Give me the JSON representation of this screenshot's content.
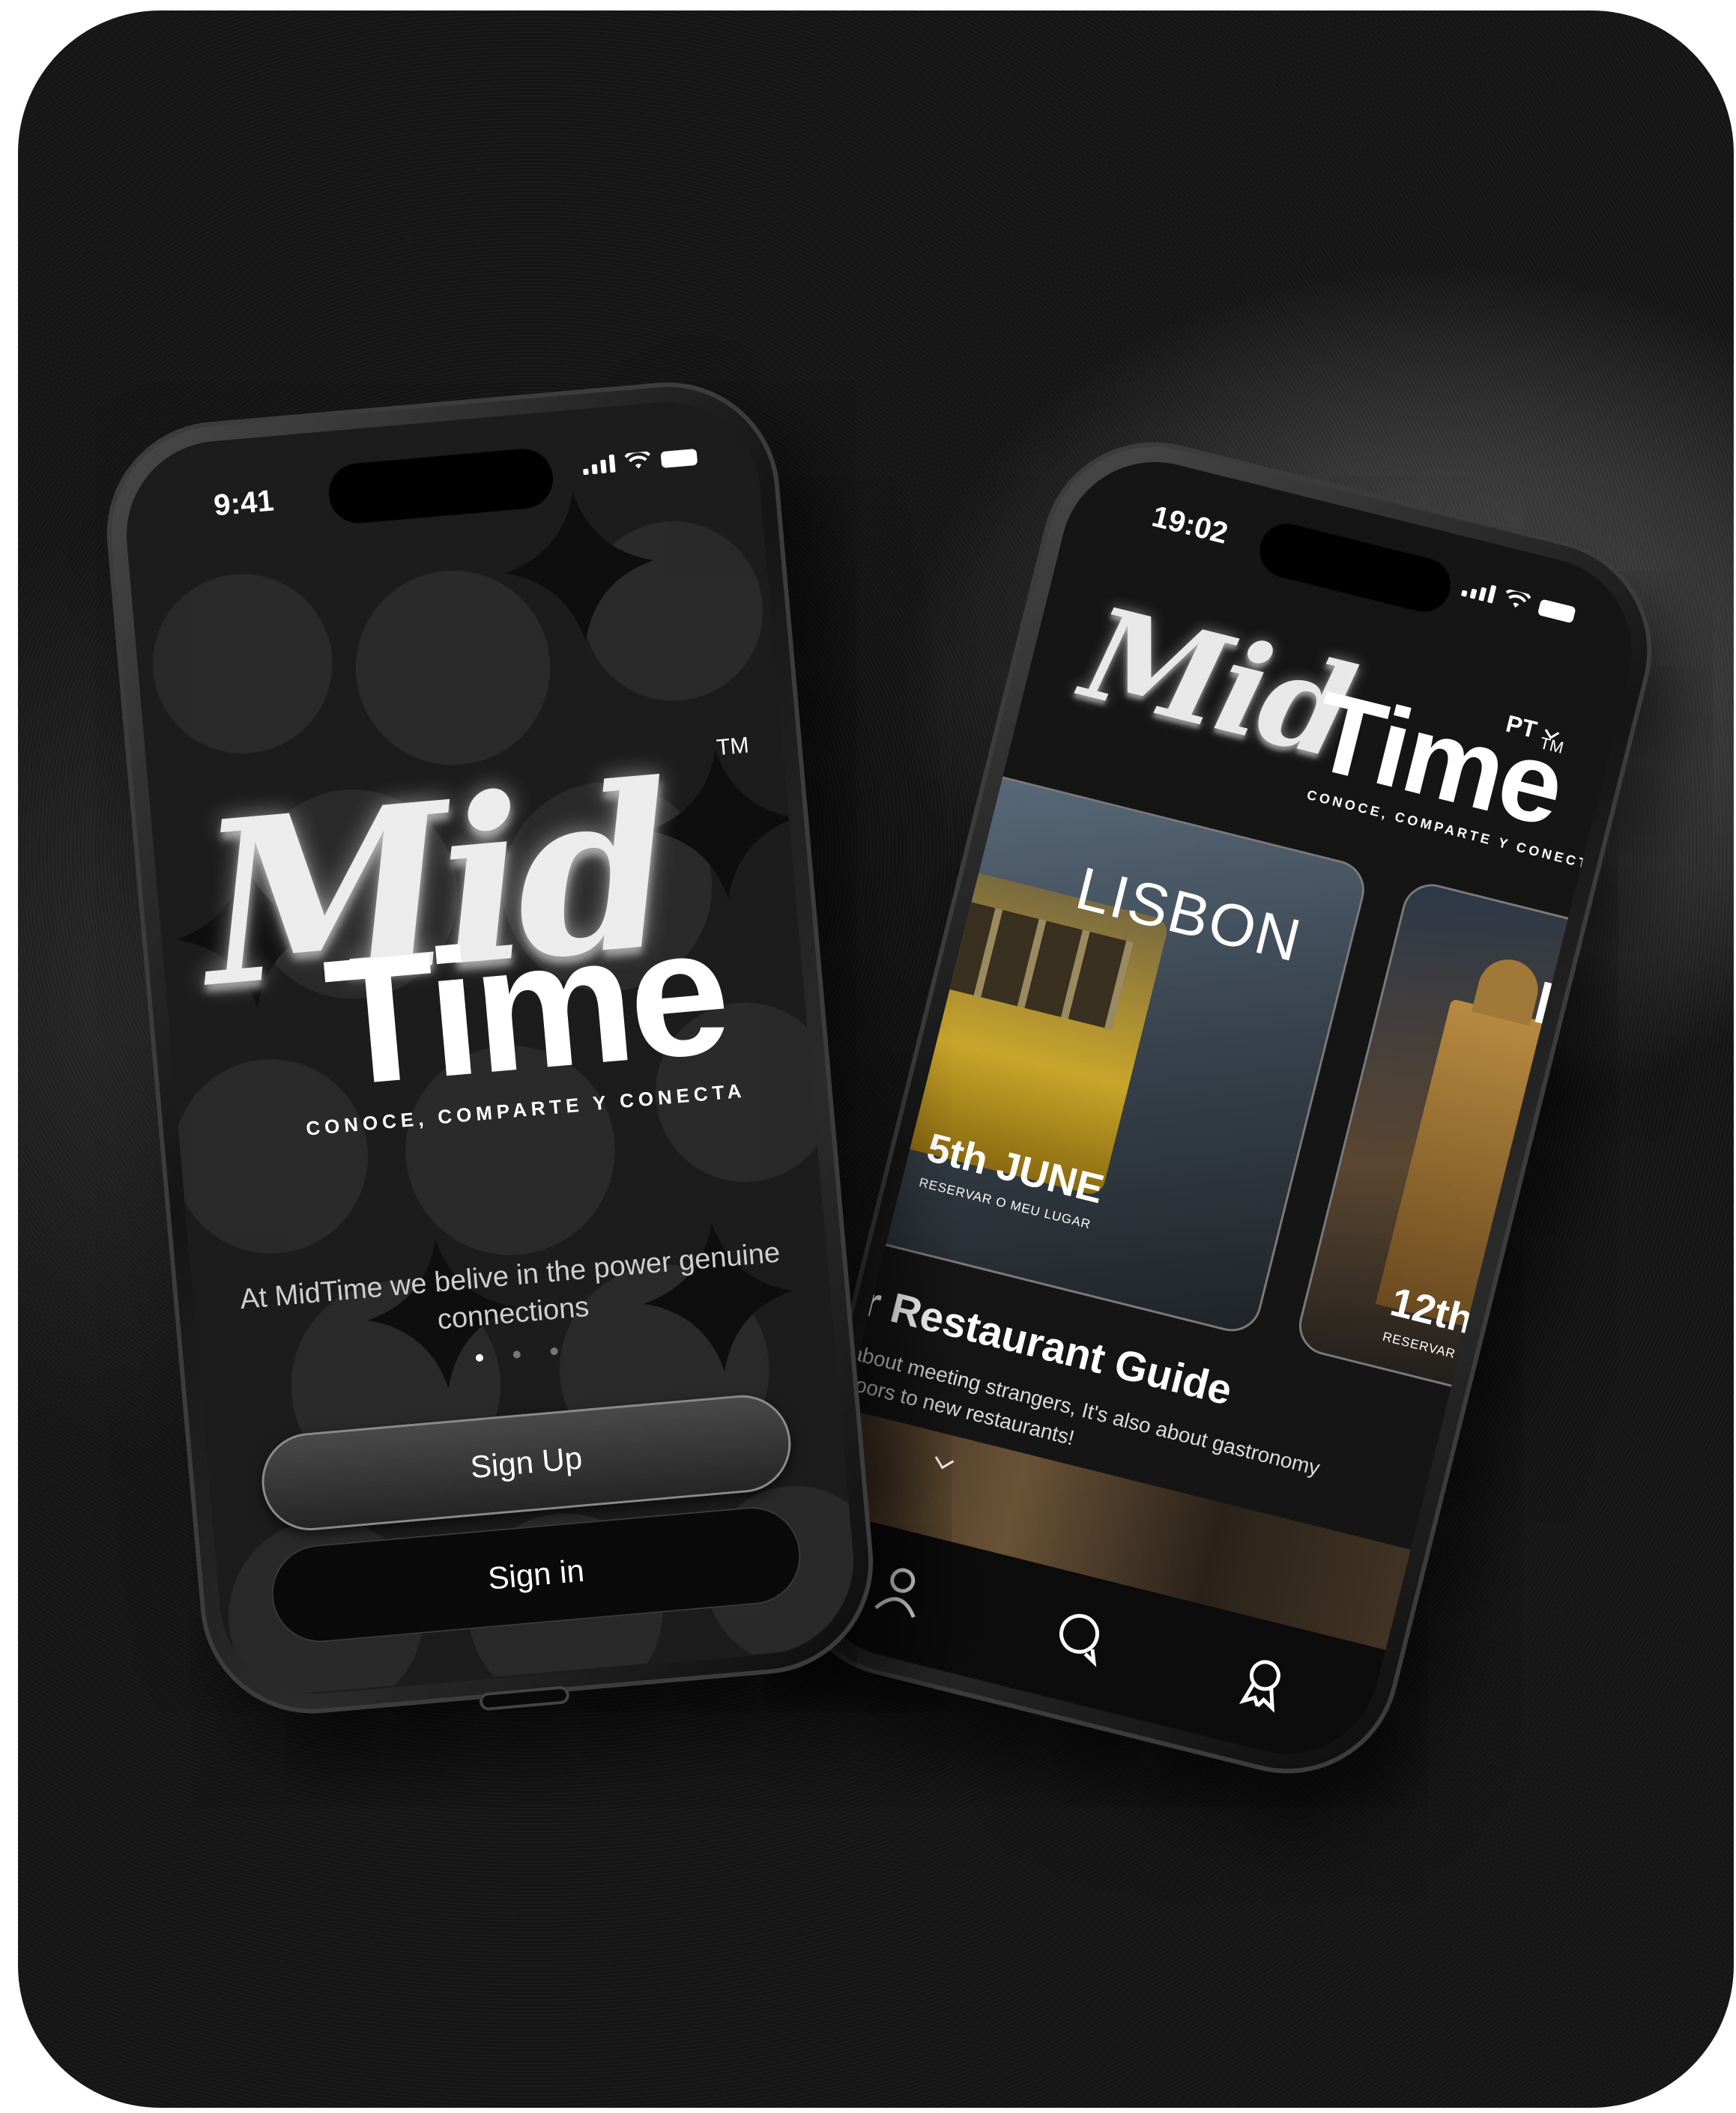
{
  "welcome_screen": {
    "status_time": "9:41",
    "logo_script": "Mid",
    "logo_word": "Time",
    "logo_tm": "TM",
    "logo_tagline": "CONOCE, COMPARTE Y CONECTA",
    "tagline": "At MidTime we belive in the power genuine connections",
    "signup_label": "Sign Up",
    "signin_label": "Sign in"
  },
  "home_screen": {
    "status_time": "19:02",
    "language": "PT",
    "logo_script": "Mid",
    "logo_word": "Time",
    "logo_tm": "TM",
    "logo_tagline": "CONOCE, COMPARTE Y CONECTA",
    "events": [
      {
        "city": "LISBON",
        "date": "5th JUNE",
        "cta": "RESERVAR O MEU LUGAR"
      },
      {
        "city": "ÉVC",
        "date": "12th",
        "cta": "RESERVAR"
      }
    ],
    "guide_title": "r Restaurant Guide",
    "guide_text_line1": "about meeting strangers, It's also about gastronomy",
    "guide_text_line2": "doors to new restaurants!",
    "tabs": [
      "profile-icon",
      "chat-icon",
      "badge-icon"
    ]
  },
  "colors": {
    "background": "#1b1b1b",
    "screen": "#151515",
    "text": "#ffffff"
  }
}
